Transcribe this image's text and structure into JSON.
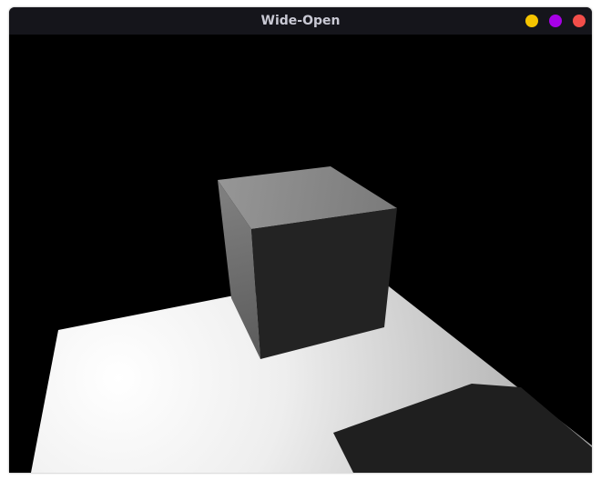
{
  "window": {
    "title": "Wide-Open"
  },
  "controls": [
    {
      "name": "minimize",
      "color": "#f5c400"
    },
    {
      "name": "maximize",
      "color": "#a700e6"
    },
    {
      "name": "close",
      "color": "#f24e4a"
    }
  ],
  "scene": {
    "background_color": "#000000",
    "floor_light_color": "#ffffff",
    "floor_shadow_color": "#1f1f1f",
    "cube_top_color": "#8c8c8c",
    "cube_left_color": "#707070",
    "cube_front_color": "#232323"
  }
}
